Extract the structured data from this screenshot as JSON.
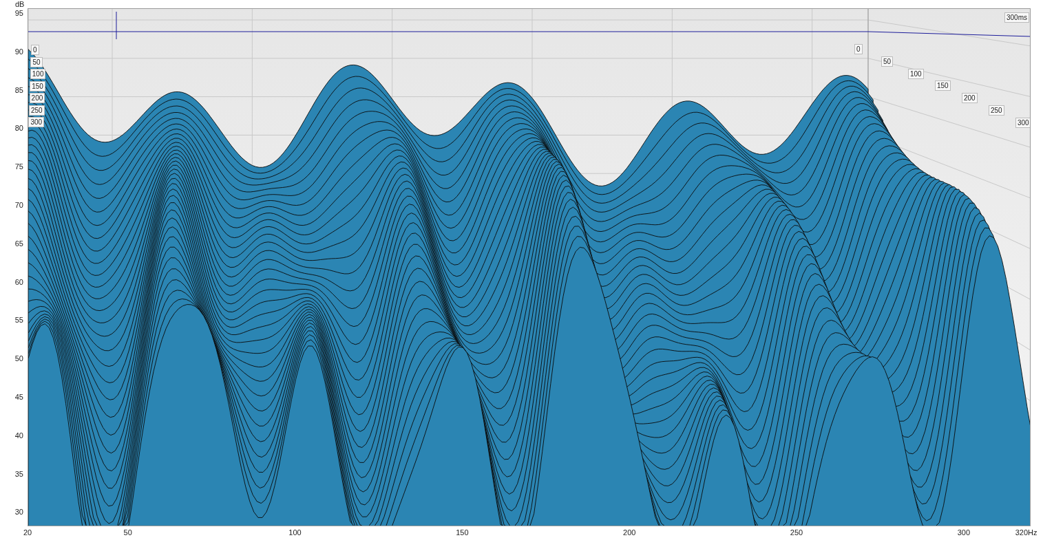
{
  "y_axis": {
    "unit": "dB",
    "ticks": [
      "95",
      "90",
      "85",
      "80",
      "75",
      "70",
      "65",
      "60",
      "55",
      "50",
      "45",
      "40",
      "35",
      "30"
    ]
  },
  "x_axis": {
    "ticks": [
      "20",
      "50",
      "100",
      "150",
      "200",
      "250",
      "300",
      "320Hz"
    ]
  },
  "time_axis": {
    "end_label": "300ms",
    "left_labels": [
      "0",
      "50",
      "100",
      "150",
      "200",
      "250",
      "300"
    ],
    "right_labels": [
      "0",
      "50",
      "100",
      "150",
      "200",
      "250",
      "300"
    ]
  }
}
